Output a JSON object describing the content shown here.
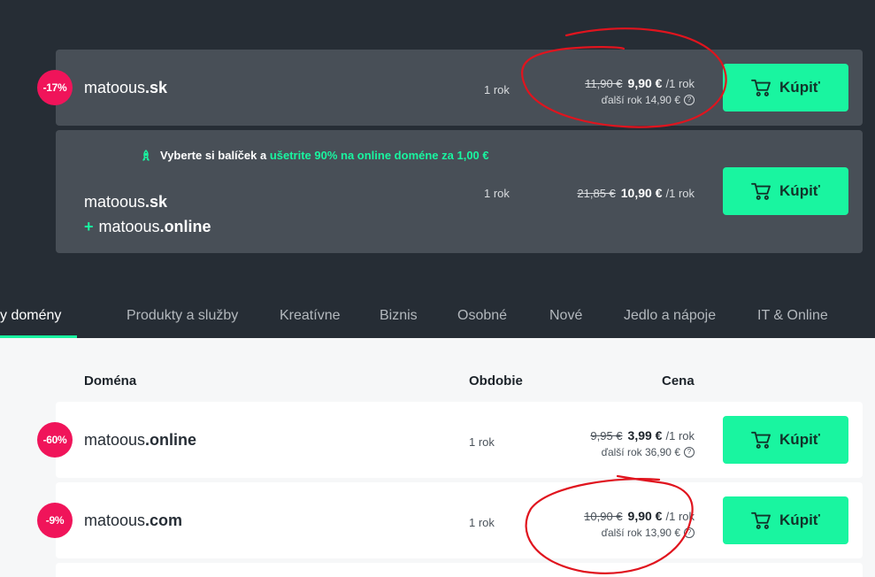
{
  "featured": [
    {
      "badge": "-17%",
      "domain_name": "matoous",
      "tld": ".sk",
      "period": "1 rok",
      "old_price": "11,90 €",
      "price": "9,90 €",
      "per": "/1 rok",
      "renewal": "ďalší rok 14,90 €",
      "buy_label": "Kúpiť"
    },
    {
      "promo_prefix": "Vyberte si balíček a ",
      "promo_highlight": "ušetrite 90% na online doméne za 1,00 €",
      "domain1_name": "matoous",
      "domain1_tld": ".sk",
      "plus": "+",
      "domain2_name": "matoous",
      "domain2_tld": ".online",
      "period": "1 rok",
      "old_price": "21,85 €",
      "price": "10,90 €",
      "per": "/1 rok",
      "buy_label": "Kúpiť",
      "promo_icon": "rocket-icon"
    }
  ],
  "tabs": [
    {
      "label": "y domény",
      "active": true
    },
    {
      "label": "Produkty a služby"
    },
    {
      "label": "Kreatívne"
    },
    {
      "label": "Biznis"
    },
    {
      "label": "Osobné"
    },
    {
      "label": "Nové"
    },
    {
      "label": "Jedlo a nápoje"
    },
    {
      "label": "IT & Online"
    }
  ],
  "table": {
    "col_domain": "Doména",
    "col_period": "Obdobie",
    "col_price": "Cena",
    "rows": [
      {
        "badge": "-60%",
        "domain_name": "matoous",
        "tld": ".online",
        "period": "1 rok",
        "old_price": "9,95 €",
        "price": "3,99 €",
        "per": "/1 rok",
        "renewal": "ďalší rok 36,90 €",
        "buy_label": "Kúpiť"
      },
      {
        "badge": "-9%",
        "domain_name": "matoous",
        "tld": ".com",
        "period": "1 rok",
        "old_price": "10,90 €",
        "price": "9,90 €",
        "per": "/1 rok",
        "renewal": "ďalší rok 13,90 €",
        "buy_label": "Kúpiť"
      }
    ]
  },
  "colors": {
    "accent": "#19f5a0",
    "badge": "#f0145a",
    "annotation": "#e0141e",
    "dark_bg": "#262d35",
    "card_dark": "#484f57"
  },
  "icons": {
    "cart": "cart-icon",
    "help": "help-icon"
  }
}
